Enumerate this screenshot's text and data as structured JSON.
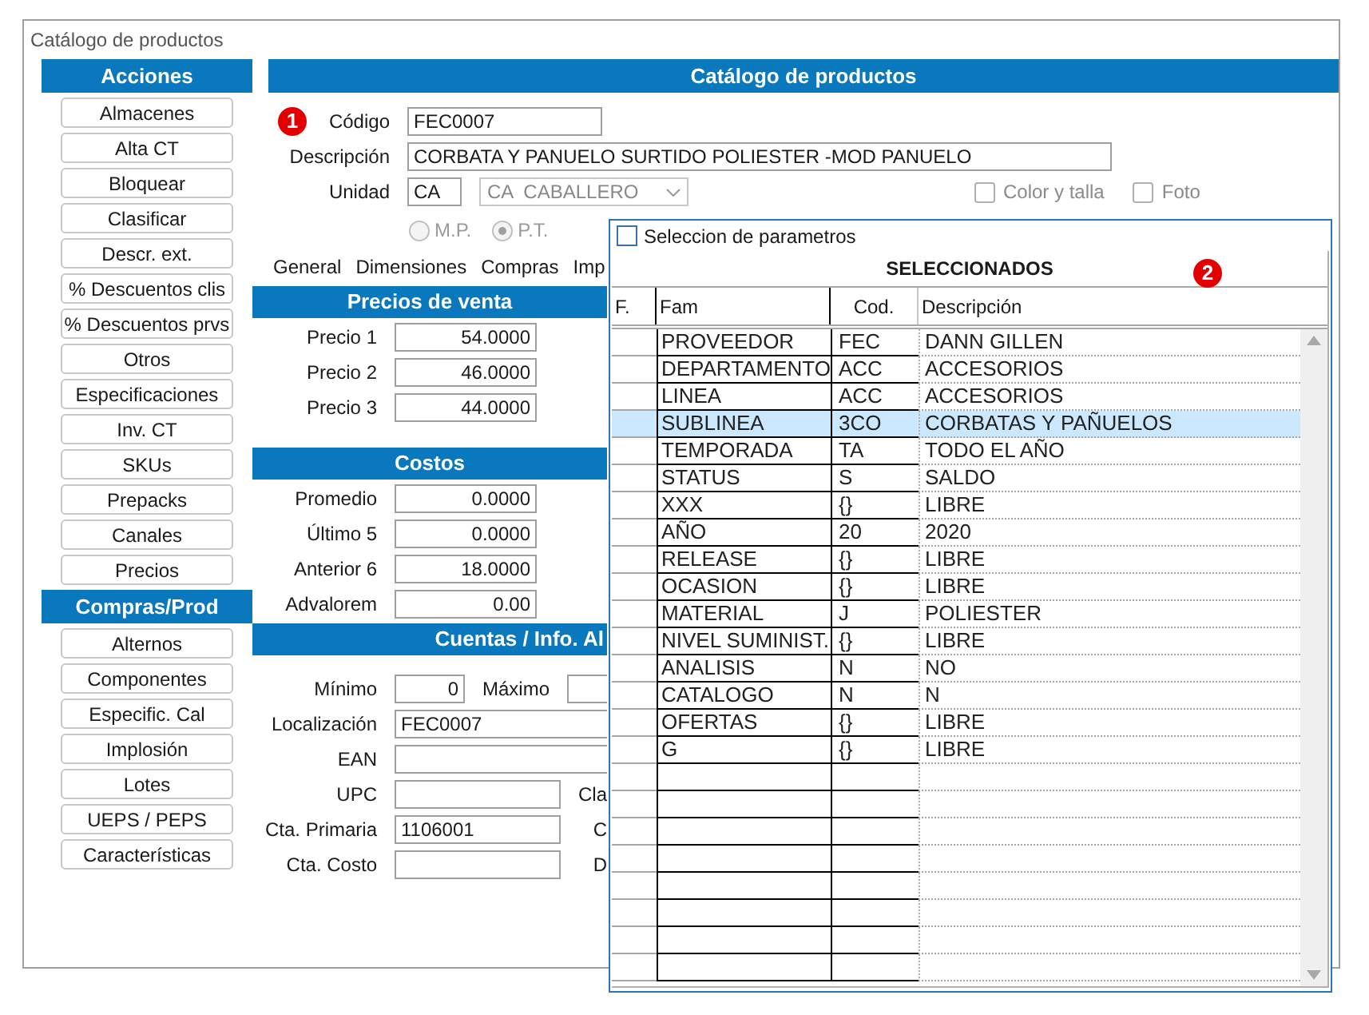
{
  "window": {
    "title": "Catálogo de productos"
  },
  "sidebar": [
    {
      "title": "Acciones",
      "buttons": [
        "Almacenes",
        "Alta CT",
        "Bloquear",
        "Clasificar",
        "Descr. ext.",
        "% Descuentos clis",
        "% Descuentos prvs",
        "Otros",
        "Especificaciones",
        "Inv. CT",
        "SKUs",
        "Prepacks",
        "Canales",
        "Precios"
      ]
    },
    {
      "title": "Compras/Prod",
      "buttons": [
        "Alternos",
        "Componentes",
        "Especific. Cal",
        "Implosión",
        "Lotes",
        "UEPS / PEPS",
        "Características"
      ]
    }
  ],
  "form": {
    "title": "Catálogo de productos",
    "marker": "1",
    "codigo": {
      "label": "Código",
      "value": "FEC0007"
    },
    "descripcion": {
      "label": "Descripción",
      "value": "CORBATA Y PANUELO SURTIDO POLIESTER -MOD PANUELO"
    },
    "unidad": {
      "label": "Unidad",
      "value": "CA",
      "select": "CA  CABALLERO"
    },
    "checkboxes": [
      {
        "label": "Color y talla",
        "checked": false
      },
      {
        "label": "Foto",
        "checked": false
      }
    ],
    "radios": [
      {
        "label": "M.P.",
        "selected": false
      },
      {
        "label": "P.T.",
        "selected": true
      }
    ],
    "tabs": [
      "General",
      "Dimensiones",
      "Compras",
      "Imp"
    ]
  },
  "precios": {
    "title": "Precios de venta",
    "rows": [
      {
        "label": "Precio 1",
        "value": "54.0000"
      },
      {
        "label": "Precio 2",
        "value": "46.0000"
      },
      {
        "label": "Precio 3",
        "value": "44.0000"
      }
    ]
  },
  "costos": {
    "title": "Costos",
    "rows": [
      {
        "label": "Promedio",
        "value": "0.0000"
      },
      {
        "label": "Último 5",
        "value": "0.0000"
      },
      {
        "label": "Anterior 6",
        "value": "18.0000"
      },
      {
        "label": "Advalorem",
        "value": "0.00"
      }
    ]
  },
  "cuentas": {
    "title": "Cuentas / Info. Al",
    "rows": [
      {
        "kind": "range",
        "label": "Mínimo",
        "value": "0",
        "second_label": "Máximo"
      },
      {
        "kind": "wide",
        "label": "Localización",
        "value": "FEC0007"
      },
      {
        "kind": "wide",
        "label": "EAN"
      },
      {
        "kind": "pair",
        "label": "UPC",
        "side_label": "Cla"
      },
      {
        "kind": "pair",
        "label": "Cta. Primaria",
        "value": "1106001",
        "side_label": "C"
      },
      {
        "kind": "pair",
        "label": "Cta. Costo",
        "side_label": "D"
      }
    ]
  },
  "dialog": {
    "title": "Seleccion de parametros",
    "heading": "SELECCIONADOS",
    "marker": "2",
    "columns": [
      "F.",
      "Fam",
      "Cod.",
      "Descripción"
    ],
    "rows": [
      {
        "fam": "PROVEEDOR",
        "cod": "FEC",
        "desc": "DANN GILLEN",
        "selected": false
      },
      {
        "fam": "DEPARTAMENTO",
        "cod": "ACC",
        "desc": "ACCESORIOS",
        "selected": false
      },
      {
        "fam": "LINEA",
        "cod": "ACC",
        "desc": "ACCESORIOS",
        "selected": false
      },
      {
        "fam": "SUBLINEA",
        "cod": "3CO",
        "desc": "CORBATAS Y PAÑUELOS",
        "selected": true
      },
      {
        "fam": "TEMPORADA",
        "cod": "TA",
        "desc": "TODO EL AÑO",
        "selected": false
      },
      {
        "fam": "STATUS",
        "cod": "S",
        "desc": "SALDO",
        "selected": false
      },
      {
        "fam": "XXX",
        "cod": "{}",
        "desc": "LIBRE",
        "selected": false
      },
      {
        "fam": "AÑO",
        "cod": "20",
        "desc": "2020",
        "selected": false
      },
      {
        "fam": "RELEASE",
        "cod": "{}",
        "desc": "LIBRE",
        "selected": false
      },
      {
        "fam": "OCASION",
        "cod": "{}",
        "desc": "LIBRE",
        "selected": false
      },
      {
        "fam": "MATERIAL",
        "cod": "J",
        "desc": "POLIESTER",
        "selected": false
      },
      {
        "fam": "NIVEL SUMINIST.",
        "cod": "{}",
        "desc": "LIBRE",
        "selected": false
      },
      {
        "fam": "ANALISIS",
        "cod": "N",
        "desc": "NO",
        "selected": false
      },
      {
        "fam": "CATALOGO",
        "cod": "N",
        "desc": "N",
        "selected": false
      },
      {
        "fam": "OFERTAS",
        "cod": "{}",
        "desc": "LIBRE",
        "selected": false
      },
      {
        "fam": "G",
        "cod": "{}",
        "desc": "LIBRE",
        "selected": false
      }
    ]
  }
}
